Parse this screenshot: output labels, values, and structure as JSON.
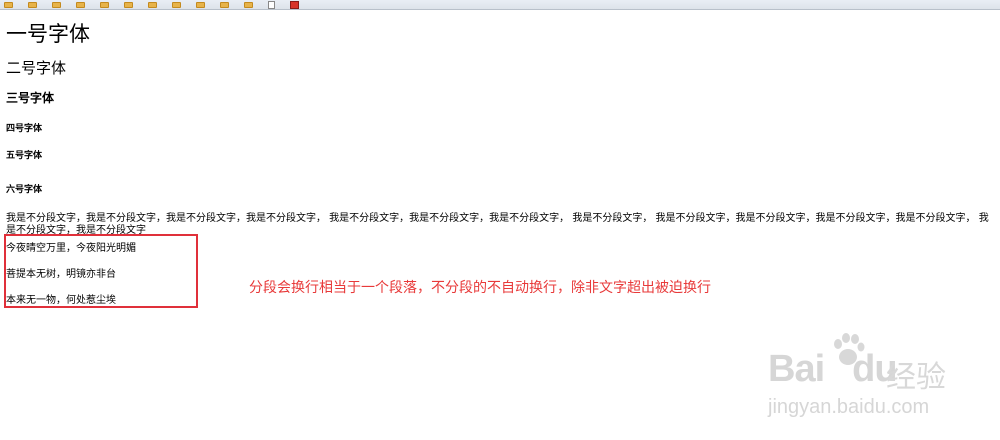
{
  "bookmarks": [
    {
      "label": "",
      "icon": "folder-icon"
    },
    {
      "label": "",
      "icon": "folder-icon"
    },
    {
      "label": "",
      "icon": "folder-icon"
    },
    {
      "label": "",
      "icon": "folder-icon"
    },
    {
      "label": "",
      "icon": "folder-icon"
    },
    {
      "label": "",
      "icon": "folder-icon"
    },
    {
      "label": "",
      "icon": "folder-icon"
    },
    {
      "label": "",
      "icon": "folder-icon"
    },
    {
      "label": "",
      "icon": "folder-icon"
    },
    {
      "label": "",
      "icon": "folder-icon"
    },
    {
      "label": "",
      "icon": "folder-icon"
    },
    {
      "label": "",
      "icon": "page-icon"
    },
    {
      "label": "",
      "icon": "app-icon"
    }
  ],
  "headings": {
    "h1": "一号字体",
    "h2": "二号字体",
    "h3": "三号字体",
    "h4": "四号字体",
    "h5": "五号字体",
    "h6": "六号字体"
  },
  "paragraph": "我是不分段文字，我是不分段文字，我是不分段文字，我是不分段文字，  我是不分段文字，我是不分段文字，我是不分段文字，  我是不分段文字，  我是不分段文字，我是不分段文字，我是不分段文字，我是不分段文字，  我是不分段文字，我是不分段文字",
  "poem": [
    "今夜晴空万里，今夜阳光明媚",
    "菩提本无树，明镜亦非台",
    "本来无一物，何处惹尘埃"
  ],
  "annotation": {
    "text": "分段会换行相当于一个段落，不分段的不自动换行，除非文字超出被迫换行",
    "color": "#e83a3a",
    "box_color": "#e0303a"
  },
  "watermark": {
    "logo_text": "Bai",
    "logo_text2": "du",
    "cn_text": "经验",
    "url": "jingyan.baidu.com"
  }
}
